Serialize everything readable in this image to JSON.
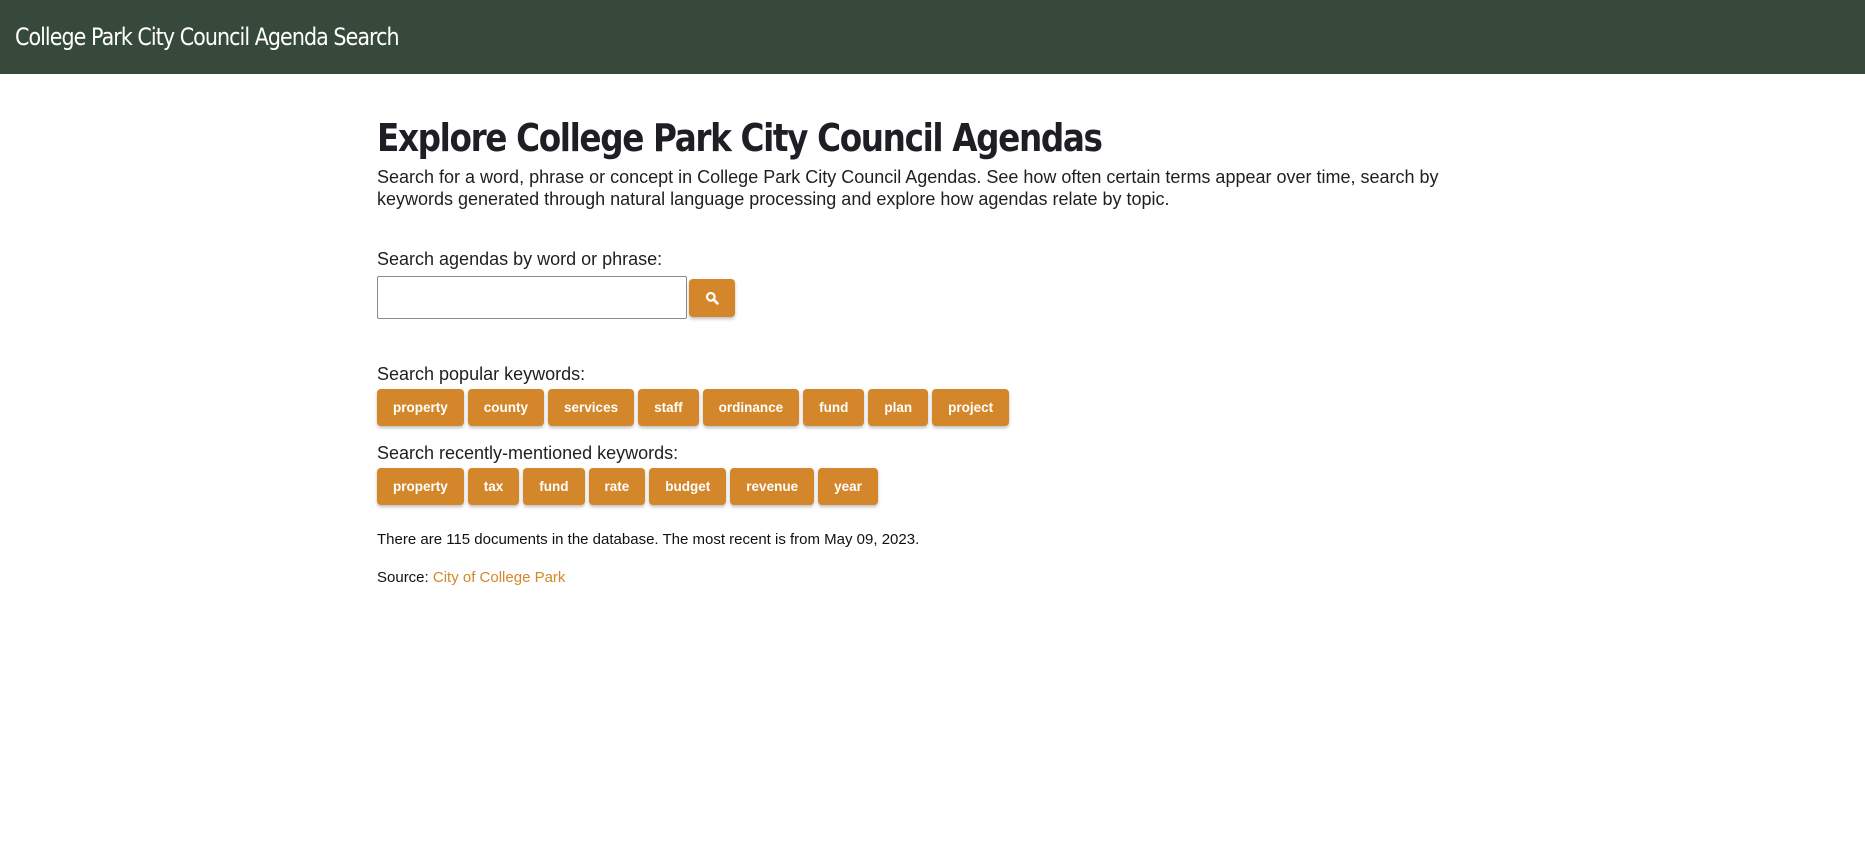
{
  "header": {
    "app_title": "College Park City Council Agenda Search",
    "background_color": "#37493a"
  },
  "main": {
    "title": "Explore College Park City Council Agendas",
    "intro": "Search for a word, phrase or concept in College Park City Council Agendas. See how often certain terms appear over time, search by keywords generated through natural language processing and explore how agendas relate by topic."
  },
  "search": {
    "label": "Search agendas by word or phrase:",
    "value": "",
    "placeholder": "",
    "button_icon": "search-icon"
  },
  "popular_keywords": {
    "label": "Search popular keywords:",
    "items": [
      "property",
      "county",
      "services",
      "staff",
      "ordinance",
      "fund",
      "plan",
      "project"
    ]
  },
  "recent_keywords": {
    "label": "Search recently-mentioned keywords:",
    "items": [
      "property",
      "tax",
      "fund",
      "rate",
      "budget",
      "revenue",
      "year"
    ]
  },
  "footer": {
    "doc_count_text": "There are 115 documents in the database. The most recent is from May 09, 2023.",
    "source_prefix": "Source: ",
    "source_link_text": "City of College Park"
  },
  "colors": {
    "accent": "#d4862a",
    "header": "#37493a"
  }
}
